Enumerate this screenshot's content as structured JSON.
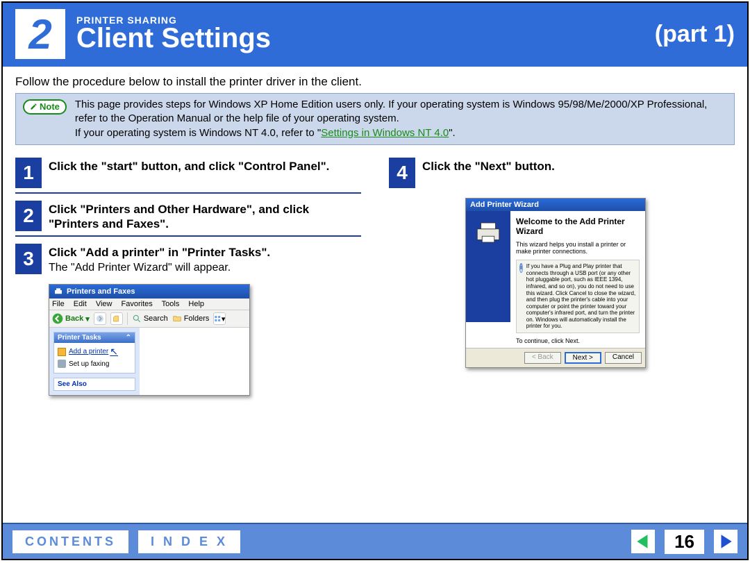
{
  "header": {
    "chapter_number": "2",
    "section_label": "PRINTER SHARING",
    "title": "Client Settings",
    "part": "(part 1)"
  },
  "intro": "Follow the procedure below to install the printer driver in the client.",
  "note": {
    "badge": "Note",
    "line1": "This page provides steps for Windows XP Home Edition users only. If your operating system is Windows 95/98/Me/2000/XP Professional, refer to the Operation Manual or the help file of your operating system.",
    "line2_prefix": "If your operating system is Windows NT 4.0, refer to \"",
    "link": "Settings in Windows NT 4.0",
    "line2_suffix": "\"."
  },
  "steps": [
    {
      "num": "1",
      "title": "Click the \"start\" button, and click \"Control Panel\"."
    },
    {
      "num": "2",
      "title": "Click \"Printers and Other Hardware\", and click \"Printers and Faxes\"."
    },
    {
      "num": "3",
      "title": "Click \"Add a printer\" in \"Printer Tasks\".",
      "sub": "The \"Add Printer Wizard\" will appear."
    },
    {
      "num": "4",
      "title": "Click the \"Next\" button."
    }
  ],
  "pf_window": {
    "title": "Printers and Faxes",
    "menu": [
      "File",
      "Edit",
      "View",
      "Favorites",
      "Tools",
      "Help"
    ],
    "back": "Back",
    "search": "Search",
    "folders": "Folders",
    "tasks_header": "Printer Tasks",
    "add_printer": "Add a printer",
    "setup_faxing": "Set up faxing",
    "see_also": "See Also"
  },
  "apw": {
    "title": "Add Printer Wizard",
    "heading": "Welcome to the Add Printer Wizard",
    "desc": "This wizard helps you install a printer or make printer connections.",
    "info": "If you have a Plug and Play printer that connects through a USB port (or any other hot pluggable port, such as IEEE 1394, infrared, and so on), you do not need to use this wizard. Click Cancel to close the wizard, and then plug the printer's cable into your computer or point the printer toward your computer's infrared port, and turn the printer on. Windows will automatically install the printer for you.",
    "continue": "To continue, click Next.",
    "btn_back": "< Back",
    "btn_next": "Next >",
    "btn_cancel": "Cancel"
  },
  "footer": {
    "contents": "CONTENTS",
    "index": "I N D E X",
    "page": "16"
  }
}
